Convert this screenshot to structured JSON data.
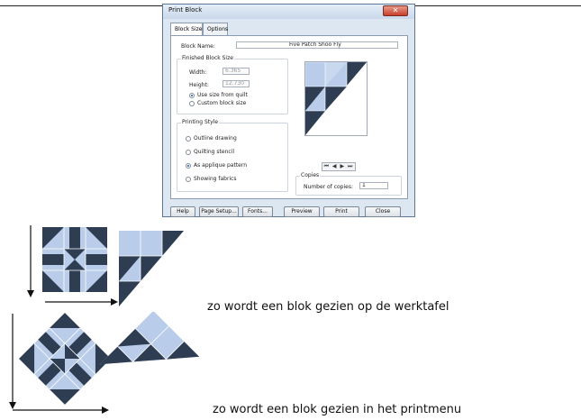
{
  "dialog": {
    "title": "Print Block",
    "close_glyph": "✕",
    "tabs": [
      {
        "label": "Block Size",
        "active": true
      },
      {
        "label": "Options",
        "active": false
      }
    ],
    "block_name": {
      "label": "Block Name:",
      "value": "Five Patch Shoo Fly"
    },
    "finished_size": {
      "title": "Finished Block Size",
      "width": {
        "label": "Width:",
        "value": "6.365"
      },
      "height": {
        "label": "Height:",
        "value": "12.730"
      },
      "options": [
        {
          "label": "Use size from quilt",
          "selected": true
        },
        {
          "label": "Custom block size",
          "selected": false
        }
      ]
    },
    "printing_style": {
      "title": "Printing Style",
      "options": [
        {
          "label": "Outline drawing",
          "selected": false
        },
        {
          "label": "Quilting stencil",
          "selected": false
        },
        {
          "label": "As applique pattern",
          "selected": true
        },
        {
          "label": "Showing fabrics",
          "selected": false
        }
      ]
    },
    "navigation": {
      "glyphs": "⏮ ◀ ▶ ⏭"
    },
    "copies": {
      "title": "Copies",
      "label": "Number of copies:",
      "value": "1"
    },
    "buttons": [
      {
        "label": "Help"
      },
      {
        "label": "Page Setup..."
      },
      {
        "label": "Fonts..."
      },
      {
        "label": "Preview"
      },
      {
        "label": "Print"
      },
      {
        "label": "Close"
      }
    ]
  },
  "captions": {
    "worktable": "zo wordt een blok gezien op de werktafel",
    "printmenu": "zo wordt een blok gezien in het printmenu"
  },
  "colors": {
    "fabric_dark": "#2e3d52",
    "fabric_light": "#b9cdea",
    "dialog_bg": "#dde7f2",
    "accent": "#1f4aa0"
  }
}
